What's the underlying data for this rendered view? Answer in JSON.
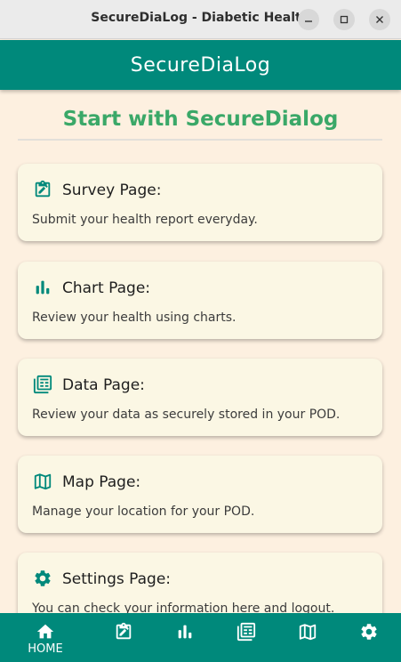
{
  "window": {
    "title": "SecureDiaLog - Diabetic Health",
    "minimize_icon": "minimize-icon",
    "maximize_icon": "maximize-icon",
    "close_icon": "close-icon"
  },
  "appbar": {
    "title": "SecureDiaLog"
  },
  "main": {
    "heading": "Start with SecureDialog",
    "cards": [
      {
        "icon": "clipboard-edit-icon",
        "title": "Survey Page:",
        "description": "Submit your health report everyday."
      },
      {
        "icon": "bar-chart-icon",
        "title": "Chart Page:",
        "description": "Review your health using charts."
      },
      {
        "icon": "table-data-icon",
        "title": "Data Page:",
        "description": "Review your data as securely stored in your POD."
      },
      {
        "icon": "map-icon",
        "title": "Map Page:",
        "description": "Manage your location for your POD."
      },
      {
        "icon": "gear-icon",
        "title": "Settings Page:",
        "description": "You can check your information here and logout."
      }
    ]
  },
  "bottom_nav": {
    "items": [
      {
        "icon": "home-icon",
        "label": "HOME",
        "selected": true
      },
      {
        "icon": "clipboard-edit-icon",
        "label": ""
      },
      {
        "icon": "bar-chart-icon",
        "label": ""
      },
      {
        "icon": "table-data-icon",
        "label": ""
      },
      {
        "icon": "map-icon",
        "label": ""
      },
      {
        "icon": "gear-icon",
        "label": ""
      }
    ]
  },
  "colors": {
    "primary": "#00897b",
    "heading": "#3aa868",
    "background": "#fdf0e0",
    "card": "#fbf7e4"
  }
}
